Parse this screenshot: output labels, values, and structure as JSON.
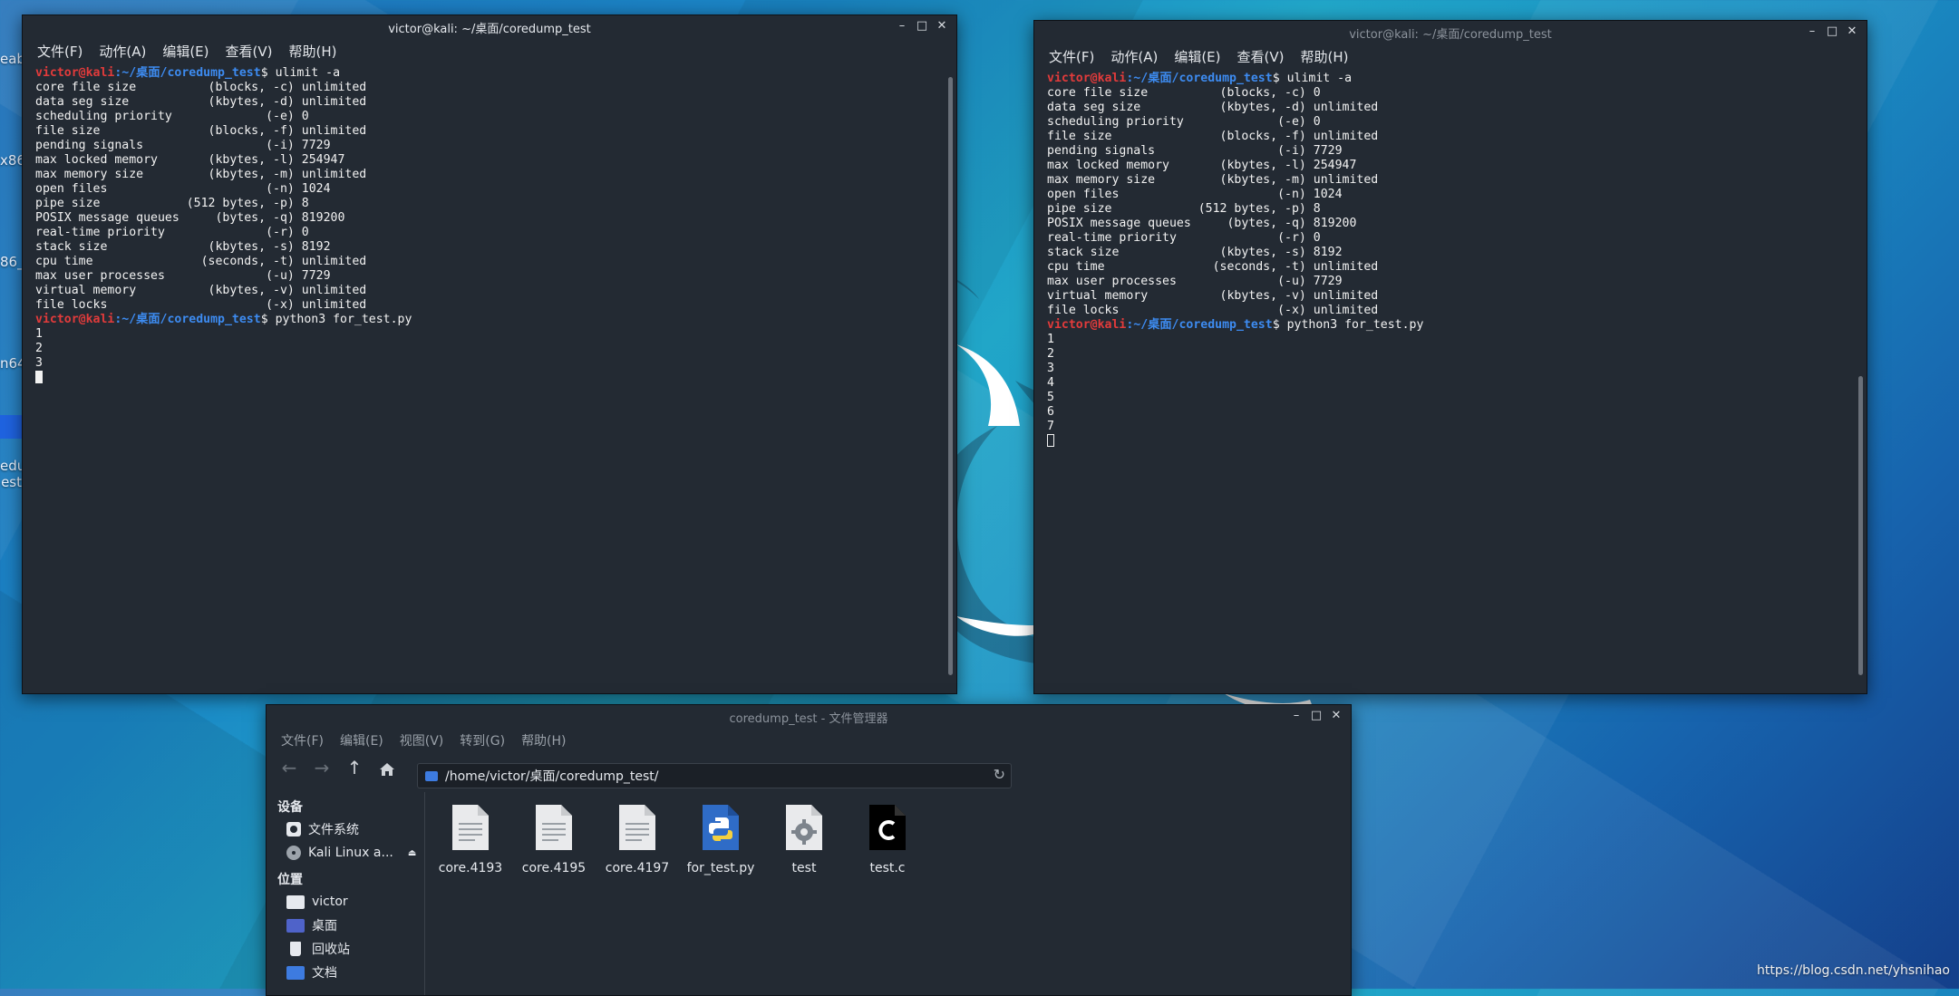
{
  "desktop": {
    "fragments": [
      "eab",
      "x86",
      "86_",
      "n64",
      "edum",
      "est"
    ],
    "watermark": "https://blog.csdn.net/yhsnihao"
  },
  "terminal_left": {
    "title": "victor@kali: ~/桌面/coredump_test",
    "menu": [
      "文件(F)",
      "动作(A)",
      "编辑(E)",
      "查看(V)",
      "帮助(H)"
    ],
    "prompt_user": "victor@kali",
    "prompt_path": ":~/桌面/coredump_test",
    "command1": "$ ulimit -a",
    "ulimit_lines": [
      "core file size          (blocks, -c) unlimited",
      "data seg size           (kbytes, -d) unlimited",
      "scheduling priority             (-e) 0",
      "file size               (blocks, -f) unlimited",
      "pending signals                 (-i) 7729",
      "max locked memory       (kbytes, -l) 254947",
      "max memory size         (kbytes, -m) unlimited",
      "open files                      (-n) 1024",
      "pipe size            (512 bytes, -p) 8",
      "POSIX message queues     (bytes, -q) 819200",
      "real-time priority              (-r) 0",
      "stack size              (kbytes, -s) 8192",
      "cpu time               (seconds, -t) unlimited",
      "max user processes              (-u) 7729",
      "virtual memory          (kbytes, -v) unlimited",
      "file locks                      (-x) unlimited"
    ],
    "command2": "$ python3 for_test.py",
    "output": [
      "1",
      "2",
      "3"
    ]
  },
  "terminal_right": {
    "title": "victor@kali: ~/桌面/coredump_test",
    "menu": [
      "文件(F)",
      "动作(A)",
      "编辑(E)",
      "查看(V)",
      "帮助(H)"
    ],
    "prompt_user": "victor@kali",
    "prompt_path": ":~/桌面/coredump_test",
    "command1": "$ ulimit -a",
    "ulimit_lines": [
      "core file size          (blocks, -c) 0",
      "data seg size           (kbytes, -d) unlimited",
      "scheduling priority             (-e) 0",
      "file size               (blocks, -f) unlimited",
      "pending signals                 (-i) 7729",
      "max locked memory       (kbytes, -l) 254947",
      "max memory size         (kbytes, -m) unlimited",
      "open files                      (-n) 1024",
      "pipe size            (512 bytes, -p) 8",
      "POSIX message queues     (bytes, -q) 819200",
      "real-time priority              (-r) 0",
      "stack size              (kbytes, -s) 8192",
      "cpu time               (seconds, -t) unlimited",
      "max user processes              (-u) 7729",
      "virtual memory          (kbytes, -v) unlimited",
      "file locks                      (-x) unlimited"
    ],
    "command2": "$ python3 for_test.py",
    "output": [
      "1",
      "2",
      "3",
      "4",
      "5",
      "6",
      "7"
    ]
  },
  "file_manager": {
    "title": "coredump_test - 文件管理器",
    "menu": [
      "文件(F)",
      "编辑(E)",
      "视图(V)",
      "转到(G)",
      "帮助(H)"
    ],
    "path": "/home/victor/桌面/coredump_test/",
    "sidebar": {
      "devices_heading": "设备",
      "devices": [
        "文件系统",
        "Kali Linux a..."
      ],
      "places_heading": "位置",
      "places": [
        "victor",
        "桌面",
        "回收站",
        "文档"
      ]
    },
    "files": [
      {
        "name": "core.4193",
        "icon": "text-file-icon"
      },
      {
        "name": "core.4195",
        "icon": "text-file-icon"
      },
      {
        "name": "core.4197",
        "icon": "text-file-icon"
      },
      {
        "name": "for_test.py",
        "icon": "python-file-icon"
      },
      {
        "name": "test",
        "icon": "executable-gear-icon"
      },
      {
        "name": "test.c",
        "icon": "c-source-icon"
      }
    ]
  }
}
